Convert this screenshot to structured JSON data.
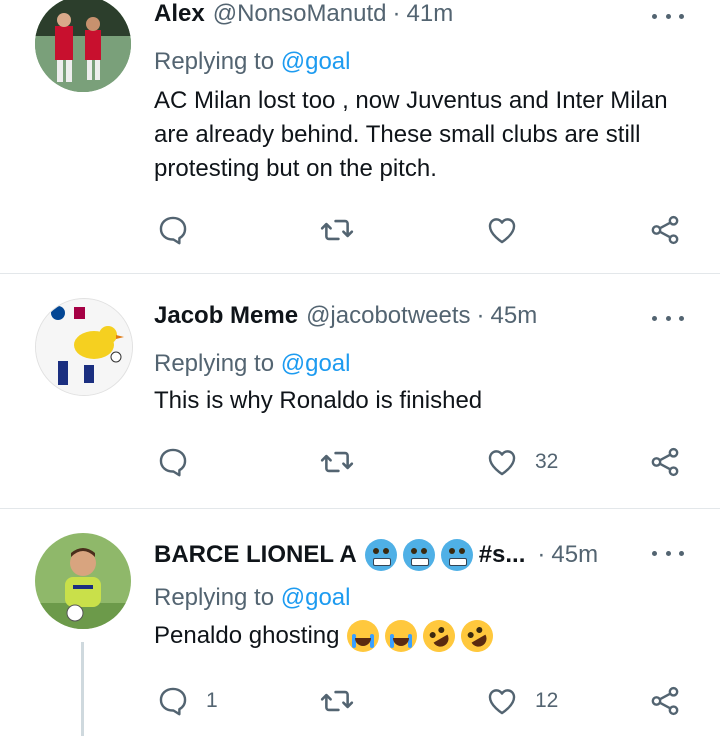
{
  "tweets": [
    {
      "name": "Alex",
      "handle": "@NonsoManutd",
      "time": "41m",
      "replying_prefix": "Replying to",
      "replying_to": "@goal",
      "text": "AC Milan lost too , now Juventus and Inter Milan are already behind.  These small clubs are still protesting but on the pitch.",
      "reply_count": "",
      "retweet_count": "",
      "like_count": ""
    },
    {
      "name": "Jacob Meme",
      "handle": "@jacobotweets",
      "time": "45m",
      "replying_prefix": "Replying to",
      "replying_to": "@goal",
      "text": "This is why Ronaldo is finished",
      "reply_count": "",
      "retweet_count": "",
      "like_count": "32"
    },
    {
      "name": "BARCE LIONEL A",
      "name_suffix": "#s...",
      "name_emojis": [
        "cold-face-emoji",
        "cold-face-emoji",
        "cold-face-emoji"
      ],
      "handle": "",
      "time": "45m",
      "replying_prefix": "Replying to",
      "replying_to": "@goal",
      "text": "Penaldo ghosting",
      "text_emojis": [
        "loudly-crying-face-emoji",
        "loudly-crying-face-emoji",
        "rolling-on-floor-laughing-emoji",
        "rolling-on-floor-laughing-emoji"
      ],
      "reply_count": "1",
      "retweet_count": "",
      "like_count": "12"
    }
  ],
  "separator": "·",
  "icons": {
    "reply": "reply-icon",
    "retweet": "retweet-icon",
    "like": "heart-icon",
    "share": "share-icon",
    "more": "more-icon"
  },
  "colors": {
    "link": "#1d9bf0",
    "secondary": "#536471",
    "divider": "#e3e7ea"
  }
}
